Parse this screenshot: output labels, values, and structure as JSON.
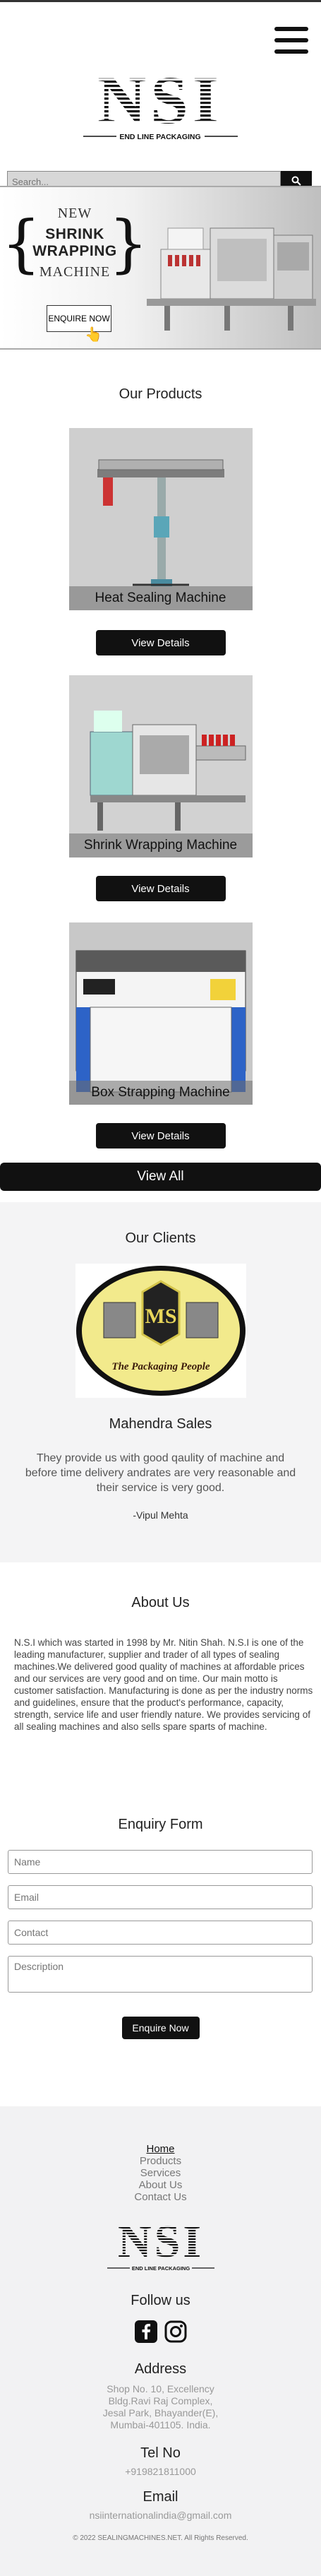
{
  "brand": {
    "logo_text": "NSI",
    "tagline": "END LINE PACKAGING"
  },
  "search": {
    "placeholder": "Search..."
  },
  "banner": {
    "line1": "NEW",
    "line2": "SHRINK WRAPPING",
    "line3": "MACHINE",
    "button": "ENQUIRE NOW"
  },
  "products": {
    "title": "Our Products",
    "items": [
      {
        "name": "Heat Sealing Machine",
        "button": "View Details"
      },
      {
        "name": "Shrink Wrapping Machine",
        "button": "View Details"
      },
      {
        "name": "Box Strapping Machine",
        "button": "View Details"
      }
    ],
    "view_all": "View All"
  },
  "clients": {
    "title": "Our Clients",
    "logo_text": "The Packaging People",
    "name": "Mahendra Sales",
    "quote": "They provide us with good qaulity of machine and before time delivery andrates are very reasonable and their service is very good.",
    "author": "-Vipul Mehta"
  },
  "about": {
    "title": "About Us",
    "text": "N.S.I which was started in 1998 by Mr. Nitin Shah. N.S.I is one of the leading manufacturer, supplier and trader of all types of sealing machines.We delivered good quality of machines at affordable prices and our services are very good and on time. Our main motto is customer satisfaction. Manufacturing is done as per the industry norms and guidelines, ensure that the product's performance, capacity, strength, service life and user friendly nature. We provides servicing of all sealing machines and also sells spare sparts of machine."
  },
  "enquiry": {
    "title": "Enquiry Form",
    "name_ph": "Name",
    "email_ph": "Email",
    "contact_ph": "Contact",
    "description_ph": "Description",
    "button": "Enquire Now"
  },
  "footer": {
    "links": [
      "Home",
      "Products",
      "Services",
      "About Us",
      "Contact Us"
    ],
    "follow_title": "Follow us",
    "address_title": "Address",
    "address_lines": [
      "Shop No. 10, Excellency",
      "Bldg.Ravi Raj Complex,",
      "Jesal Park, Bhayander(E),",
      "Mumbai-401105. India."
    ],
    "tel_title": "Tel No",
    "tel": "+919821811000",
    "email_title": "Email",
    "email": "nsiinternationalindia@gmail.com",
    "copyright": "© 2022 SEALINGMACHINES.NET. All Rights Reserved."
  },
  "colors": {
    "accent": "#111111",
    "section_bg": "#f4f4f5",
    "client_logo_bg": "#f2ea8c"
  }
}
